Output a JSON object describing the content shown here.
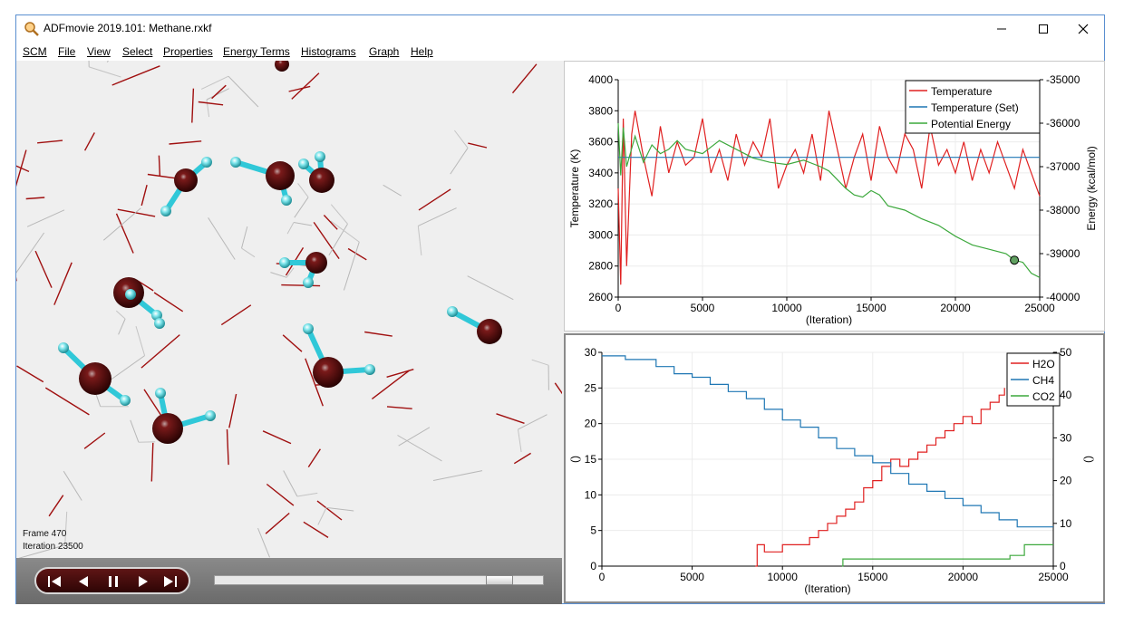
{
  "window": {
    "title": "ADFmovie 2019.101: Methane.rxkf",
    "minimize_icon": "minimize-icon",
    "maximize_icon": "maximize-icon",
    "close_icon": "close-icon"
  },
  "menu": [
    "SCM",
    "File",
    "View",
    "Select",
    "Properties",
    "Energy Terms",
    "Histograms",
    "Graph",
    "Help"
  ],
  "viewer": {
    "frame_label": "Frame 470",
    "iteration_label": "Iteration 23500",
    "slider_position": 0.9
  },
  "colors": {
    "temperature": "#e02020",
    "temperature_set": "#1f77b4",
    "potential_energy": "#3ca83c",
    "h2o": "#e02020",
    "ch4": "#1f77b4",
    "co2": "#3ca83c",
    "atom_dark": "#5a0a0a",
    "atom_h": "#40d0d8"
  },
  "chart_data": [
    {
      "type": "line",
      "xlabel": "(Iteration)",
      "ylabel": "Temperature (K)",
      "y2label": "Energy (kcal/mol)",
      "xlim": [
        0,
        25000
      ],
      "ylim": [
        2600,
        4000
      ],
      "y2lim": [
        -40000,
        -35000
      ],
      "x_ticks": [
        "0",
        "5000",
        "10000",
        "15000",
        "20000",
        "25000"
      ],
      "y_ticks": [
        "2600",
        "2800",
        "3000",
        "3200",
        "3400",
        "3600",
        "3800",
        "4000"
      ],
      "y2_ticks": [
        "-40000",
        "-39000",
        "-38000",
        "-37000",
        "-36000",
        "-35000"
      ],
      "legend": [
        "Temperature",
        "Temperature (Set)",
        "Potential Energy"
      ],
      "legend_position": "top-right",
      "grid": true,
      "marker_point": {
        "x": 23500,
        "y2": -39150
      },
      "series": [
        {
          "name": "Temperature",
          "axis": "left",
          "x": [
            0,
            150,
            300,
            500,
            800,
            1000,
            1500,
            2000,
            2500,
            3000,
            3500,
            4000,
            4500,
            5000,
            5500,
            6000,
            6500,
            7000,
            7500,
            8000,
            8500,
            9000,
            9500,
            10000,
            10500,
            11000,
            11500,
            12000,
            12500,
            13000,
            13500,
            14000,
            14500,
            15000,
            15500,
            16000,
            16500,
            17000,
            17500,
            18000,
            18500,
            19000,
            19500,
            20000,
            20500,
            21000,
            21500,
            22000,
            22500,
            23000,
            23500,
            24000,
            24500,
            25000
          ],
          "values": [
            3300,
            2680,
            3750,
            2800,
            3650,
            3800,
            3500,
            3250,
            3700,
            3400,
            3600,
            3450,
            3500,
            3750,
            3400,
            3550,
            3350,
            3650,
            3450,
            3600,
            3500,
            3750,
            3300,
            3450,
            3550,
            3400,
            3650,
            3350,
            3800,
            3550,
            3300,
            3500,
            3650,
            3350,
            3700,
            3500,
            3400,
            3650,
            3550,
            3300,
            3700,
            3450,
            3550,
            3400,
            3600,
            3350,
            3550,
            3400,
            3600,
            3450,
            3300,
            3550,
            3400,
            3250
          ]
        },
        {
          "name": "Temperature (Set)",
          "axis": "left",
          "x": [
            0,
            25000
          ],
          "values": [
            3500,
            3500
          ]
        },
        {
          "name": "Potential Energy",
          "axis": "right",
          "x": [
            0,
            150,
            300,
            500,
            1000,
            1500,
            2000,
            2500,
            3000,
            3500,
            4000,
            5000,
            6000,
            7000,
            8000,
            9000,
            10000,
            11000,
            12000,
            12500,
            13000,
            13500,
            14000,
            14500,
            15000,
            15500,
            16000,
            17000,
            18000,
            19000,
            20000,
            20500,
            21000,
            22000,
            23000,
            23500,
            24000,
            24500,
            25000
          ],
          "values": [
            -36000,
            -37200,
            -36100,
            -37000,
            -36300,
            -36900,
            -36500,
            -36700,
            -36600,
            -36400,
            -36600,
            -36700,
            -36400,
            -36600,
            -36800,
            -36900,
            -36950,
            -36850,
            -37000,
            -37100,
            -37300,
            -37500,
            -37650,
            -37700,
            -37550,
            -37650,
            -37900,
            -38000,
            -38200,
            -38350,
            -38600,
            -38700,
            -38800,
            -38900,
            -39000,
            -39150,
            -39200,
            -39450,
            -39550
          ]
        }
      ]
    },
    {
      "type": "line",
      "xlabel": "(Iteration)",
      "ylabel": "()",
      "y2label": "()",
      "xlim": [
        0,
        25000
      ],
      "ylim": [
        0,
        30
      ],
      "y2lim": [
        0,
        50
      ],
      "x_ticks": [
        "0",
        "5000",
        "10000",
        "15000",
        "20000",
        "25000"
      ],
      "y_ticks": [
        "0",
        "5",
        "10",
        "15",
        "20",
        "25",
        "30"
      ],
      "y2_ticks": [
        "0",
        "10",
        "20",
        "30",
        "40",
        "50"
      ],
      "legend": [
        "H2O",
        "CH4",
        "CO2"
      ],
      "legend_position": "top-right",
      "grid": true,
      "series": [
        {
          "name": "H2O",
          "axis": "left",
          "x": [
            8500,
            8600,
            9000,
            10000,
            11000,
            11500,
            12000,
            12500,
            13000,
            13500,
            14000,
            14500,
            15000,
            15500,
            16000,
            16500,
            17000,
            17500,
            18000,
            18500,
            19000,
            19500,
            20000,
            20500,
            21000,
            21500,
            22000,
            22300
          ],
          "values": [
            0,
            3,
            2,
            3,
            3,
            4,
            5,
            6,
            7,
            8,
            9,
            11,
            12,
            14,
            15,
            14,
            15,
            16,
            17,
            18,
            19,
            20,
            21,
            20,
            22,
            23,
            24,
            25
          ]
        },
        {
          "name": "CH4",
          "axis": "left",
          "x": [
            0,
            1300,
            2000,
            3000,
            4000,
            5000,
            6000,
            7000,
            8000,
            9000,
            10000,
            11000,
            12000,
            13000,
            14000,
            15000,
            16000,
            17000,
            18000,
            19000,
            20000,
            21000,
            22000,
            23000,
            25000
          ],
          "values": [
            29.5,
            29,
            29,
            28,
            27,
            26.5,
            25.5,
            24.5,
            23.5,
            22,
            20.5,
            19.5,
            18,
            16.5,
            15.5,
            14.5,
            13,
            11.5,
            10.5,
            9.5,
            8.5,
            7.5,
            6.5,
            5.5,
            5.5
          ]
        },
        {
          "name": "CO2",
          "axis": "left",
          "x": [
            13300,
            13350,
            22500,
            22600,
            23300,
            23400,
            24000,
            25000
          ],
          "values": [
            0,
            1,
            1,
            1.5,
            1.5,
            3,
            3,
            3
          ]
        }
      ]
    }
  ]
}
